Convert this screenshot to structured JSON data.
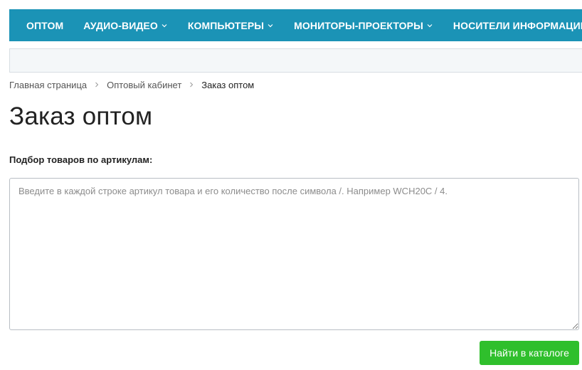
{
  "nav": {
    "items": [
      {
        "label": "ОПТОМ",
        "has_dropdown": false
      },
      {
        "label": "АУДИО-ВИДЕО",
        "has_dropdown": true
      },
      {
        "label": "КОМПЬЮТЕРЫ",
        "has_dropdown": true
      },
      {
        "label": "МОНИТОРЫ-ПРОЕКТОРЫ",
        "has_dropdown": true
      },
      {
        "label": "НОСИТЕЛИ ИНФОРМАЦИИ",
        "has_dropdown": true
      }
    ],
    "background_color": "#1b93b6"
  },
  "breadcrumb": {
    "items": [
      "Главная страница",
      "Оптовый кабинет"
    ],
    "current": "Заказ оптом"
  },
  "page_title": "Заказ оптом",
  "form": {
    "label": "Подбор товаров по артикулам:",
    "textarea_value": "",
    "textarea_placeholder": "Введите в каждой строке артикул товара и его количество после символа /. Например WCH20C / 4.",
    "submit_label": "Найти в каталоге",
    "submit_color": "#2fbf2c"
  }
}
